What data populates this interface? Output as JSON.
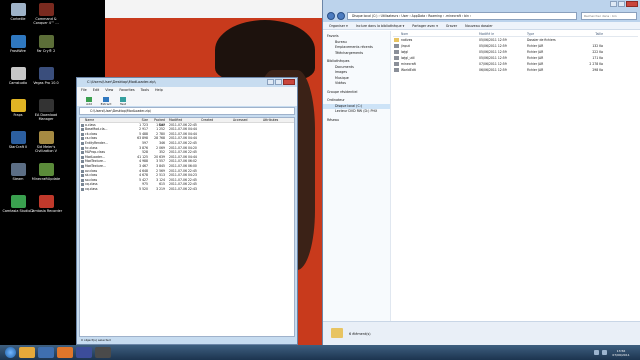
{
  "desktop": {
    "icons": [
      {
        "label": "Corbeille",
        "color": "#9fb3c8"
      },
      {
        "label": "Command & Conquer 4™ ...",
        "color": "#7a2a1f"
      },
      {
        "label": "FrostWire",
        "color": "#2f78c0"
      },
      {
        "label": "Far Cry® 2",
        "color": "#5c6e38"
      },
      {
        "label": "Camstudio",
        "color": "#c7c7c7"
      },
      {
        "label": "Vegas Pro 10.0",
        "color": "#3a4e7c"
      },
      {
        "label": "Fraps",
        "color": "#e0b424"
      },
      {
        "label": "EA Download Manager",
        "color": "#333333"
      },
      {
        "label": "StarCraft II",
        "color": "#2c5fa0"
      },
      {
        "label": "Sid Meier's Civilization V",
        "color": "#a58a42"
      },
      {
        "label": "Steam",
        "color": "#5c6e85"
      },
      {
        "label": "MinecraftUpdate",
        "color": "#5b8b3a"
      },
      {
        "label": "Camtasia Studio 7",
        "color": "#3aa04f"
      },
      {
        "label": "Camtasia Recorder",
        "color": "#c0392b"
      }
    ]
  },
  "zipwin": {
    "title": "C:\\Users\\User\\Desktop\\ModLoader.zip\\",
    "menu": [
      "File",
      "Edit",
      "View",
      "Favorites",
      "Tools",
      "Help"
    ],
    "toolbar": [
      "Add",
      "Extract",
      "Test"
    ],
    "address": "C:\\Users\\User\\Desktop\\ModLoader.zip\\",
    "columns": [
      "Name",
      "Size",
      "Packed Size",
      "Modified",
      "Created",
      "Accessed",
      "Attributes"
    ],
    "rows": [
      {
        "name": "a.class",
        "size": "1 723",
        "packed": "1 047",
        "modified": "2011-07-06 22:45"
      },
      {
        "name": "BaseMod.cla...",
        "size": "2 917",
        "packed": "1 252",
        "modified": "2011-07-06 04:44"
      },
      {
        "name": "ck.class",
        "size": "5 488",
        "packed": "2 780",
        "modified": "2011-07-06 04:44"
      },
      {
        "name": "cs.class",
        "size": "63 898",
        "packed": "28 768",
        "modified": "2011-07-06 04:44"
      },
      {
        "name": "EntityRender...",
        "size": "597",
        "packed": "346",
        "modified": "2011-07-06 22:45"
      },
      {
        "name": "hc.class",
        "size": "3 876",
        "packed": "2 069",
        "modified": "2011-07-06 04:20"
      },
      {
        "name": "MLProp.class",
        "size": "528",
        "packed": "352",
        "modified": "2011-07-06 22:45"
      },
      {
        "name": "ModLoader...",
        "size": "41 125",
        "packed": "20 639",
        "modified": "2011-07-06 04:44"
      },
      {
        "name": "ModTexture...",
        "size": "4 988",
        "packed": "3 557",
        "modified": "2011-07-06 06:02"
      },
      {
        "name": "ModTexture...",
        "size": "3 467",
        "packed": "3 845",
        "modified": "2011-07-06 06:00"
      },
      {
        "name": "ov.class",
        "size": "4 648",
        "packed": "2 569",
        "modified": "2011-07-06 22:45"
      },
      {
        "name": "sk.class",
        "size": "4 678",
        "packed": "2 513",
        "modified": "2011-07-06 04:23"
      },
      {
        "name": "so.class",
        "size": "5 427",
        "packed": "3 124",
        "modified": "2011-07-06 22:45"
      },
      {
        "name": "xq.class",
        "size": "975",
        "packed": "615",
        "modified": "2011-07-06 22:45"
      },
      {
        "name": "xq.class",
        "size": "5 520",
        "packed": "3 219",
        "modified": "2011-07-06 22:43"
      }
    ],
    "status": "0 object(s) selected"
  },
  "explorer": {
    "address": "Disque local (C:) › Utilisateurs › User › AppData › Roaming › .minecraft › bin ›",
    "search_placeholder": "Rechercher dans : bin",
    "commands": [
      "Organiser ▾",
      "Inclure dans la bibliothèque ▾",
      "Partager avec ▾",
      "Graver",
      "Nouveau dossier"
    ],
    "nav": [
      {
        "label": "Favoris",
        "level": "hdr",
        "selected": false
      },
      {
        "label": "Bureau",
        "level": "sub",
        "selected": false
      },
      {
        "label": "Emplacements récents",
        "level": "sub",
        "selected": false
      },
      {
        "label": "Téléchargements",
        "level": "sub",
        "selected": false
      },
      {
        "label": "Bibliothèques",
        "level": "hdr",
        "selected": false
      },
      {
        "label": "Documents",
        "level": "sub",
        "selected": false
      },
      {
        "label": "Images",
        "level": "sub",
        "selected": false
      },
      {
        "label": "Musique",
        "level": "sub",
        "selected": false
      },
      {
        "label": "Vidéos",
        "level": "sub",
        "selected": false
      },
      {
        "label": "Groupe résidentiel",
        "level": "hdr",
        "selected": false
      },
      {
        "label": "Ordinateur",
        "level": "hdr",
        "selected": false
      },
      {
        "label": "Disque local (C:)",
        "level": "sub",
        "selected": true
      },
      {
        "label": "Lecteur DVD RW (D:) PHX",
        "level": "sub",
        "selected": false
      },
      {
        "label": "Réseau",
        "level": "hdr",
        "selected": false
      }
    ],
    "columns": [
      "Nom",
      "Modifié le",
      "Type",
      "Taille"
    ],
    "files": [
      {
        "name": "natives",
        "modified": "05/06/2011 12:59",
        "type": "Dossier de fichiers",
        "size": "",
        "folder": true
      },
      {
        "name": "jinput",
        "modified": "05/06/2011 12:59",
        "type": "Fichier JAR",
        "size": "132 Ko",
        "folder": false
      },
      {
        "name": "lwjgl",
        "modified": "05/06/2011 12:59",
        "type": "Fichier JAR",
        "size": "222 Ko",
        "folder": false
      },
      {
        "name": "lwjgl_util",
        "modified": "05/06/2011 12:59",
        "type": "Fichier JAR",
        "size": "171 Ko",
        "folder": false
      },
      {
        "name": "minecraft",
        "modified": "07/06/2011 12:59",
        "type": "Fichier JAR",
        "size": "2 278 Ko",
        "folder": false
      },
      {
        "name": "WorldEdit",
        "modified": "06/06/2011 12:59",
        "type": "Fichier JAR",
        "size": "298 Ko",
        "folder": false
      }
    ],
    "status": "6 élément(s)"
  },
  "taskbar": {
    "time": "13:56",
    "date": "07/06/2011",
    "pinned_colors": [
      "#e6a93a",
      "#3f6fb0",
      "#e0762b",
      "#3c4d9a",
      "#4a4a4a"
    ]
  }
}
